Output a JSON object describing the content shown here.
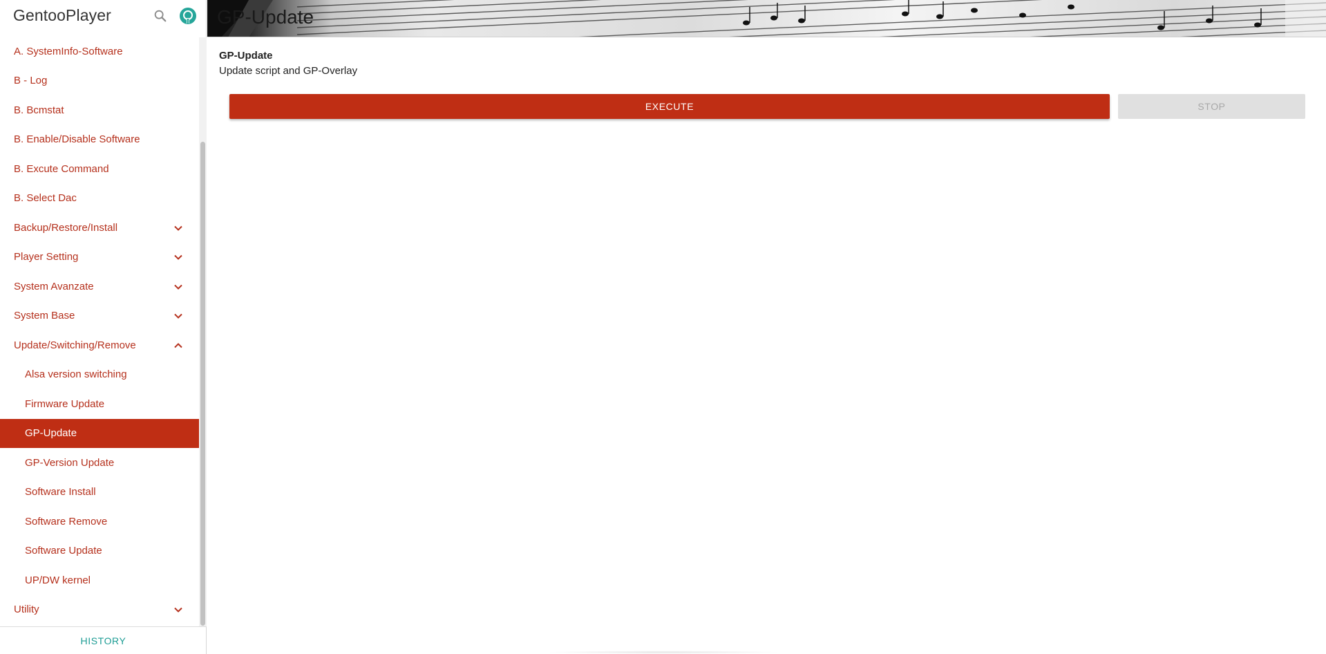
{
  "app": {
    "name": "GentooPlayer",
    "icons": {
      "search": "search-icon",
      "github": "github-icon"
    }
  },
  "sidebar": {
    "items": [
      {
        "label": "A. SystemInfo-Software",
        "expandable": false
      },
      {
        "label": "B - Log",
        "expandable": false
      },
      {
        "label": "B. Bcmstat",
        "expandable": false
      },
      {
        "label": "B. Enable/Disable Software",
        "expandable": false
      },
      {
        "label": "B. Excute Command",
        "expandable": false
      },
      {
        "label": "B. Select Dac",
        "expandable": false
      },
      {
        "label": "Backup/Restore/Install",
        "expandable": true,
        "expanded": false
      },
      {
        "label": "Player Setting",
        "expandable": true,
        "expanded": false
      },
      {
        "label": "System Avanzate",
        "expandable": true,
        "expanded": false
      },
      {
        "label": "System Base",
        "expandable": true,
        "expanded": false
      },
      {
        "label": "Update/Switching/Remove",
        "expandable": true,
        "expanded": true
      },
      {
        "label": "Alsa version switching",
        "sub": true
      },
      {
        "label": "Firmware Update",
        "sub": true
      },
      {
        "label": "GP-Update",
        "sub": true,
        "active": true
      },
      {
        "label": "GP-Version Update",
        "sub": true
      },
      {
        "label": "Software Install",
        "sub": true
      },
      {
        "label": "Software Remove",
        "sub": true
      },
      {
        "label": "Software Update",
        "sub": true
      },
      {
        "label": "UP/DW kernel",
        "sub": true
      },
      {
        "label": "Utility",
        "expandable": true,
        "expanded": false
      }
    ],
    "history_label": "HISTORY"
  },
  "header": {
    "title": "GP-Update"
  },
  "main": {
    "title": "GP-Update",
    "subtitle": "Update script and GP-Overlay",
    "execute_label": "EXECUTE",
    "stop_label": "STOP"
  },
  "colors": {
    "accent": "#bf2e14",
    "link": "#b5301c",
    "history": "#1c9c94",
    "disabled_bg": "#e0e0e0",
    "disabled_text": "#a8a8a8"
  }
}
